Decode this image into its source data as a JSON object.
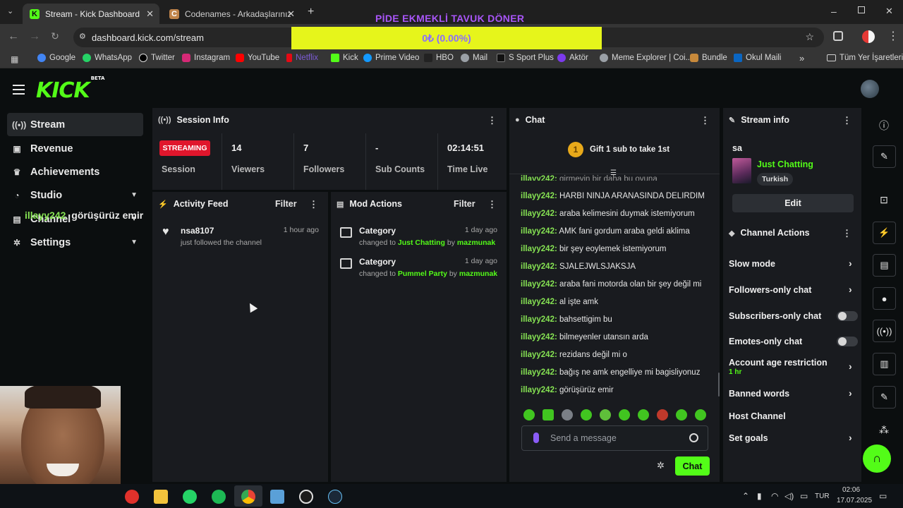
{
  "browser": {
    "tabs": [
      {
        "title": "Stream - Kick Dashboard",
        "active": true
      },
      {
        "title": "Codenames - Arkadaşlarınızla ç",
        "active": false
      }
    ],
    "url": "dashboard.kick.com/stream",
    "bookmarks": [
      "Google",
      "WhatsApp",
      "Twitter",
      "Instagram",
      "YouTube",
      "Netflix",
      "Kick",
      "Prime Video",
      "HBO",
      "Mail",
      "S Sport Plus",
      "Aktör",
      "Meme Explorer | Coi...",
      "Bundle",
      "Okul Maili"
    ],
    "bookmarks_more": "»",
    "all_bookmarks": "Tüm Yer İşaretleri"
  },
  "overlay": {
    "title": "PİDE EKMEKLİ TAVUK DÖNER",
    "progress_text": "0₺ (0.00%)",
    "progress": 0.0,
    "chat_user": "illayy242",
    "chat_text": "görüşürüz emir"
  },
  "kick": {
    "logo": "KICK",
    "logo_badge": "BETA"
  },
  "sidebar": {
    "items": [
      {
        "label": "Stream"
      },
      {
        "label": "Revenue"
      },
      {
        "label": "Achievements"
      },
      {
        "label": "Studio"
      },
      {
        "label": "Channel"
      },
      {
        "label": "Settings"
      }
    ]
  },
  "session": {
    "title": "Session Info",
    "badge": "STREAMING",
    "badge_label": "Session",
    "stats": [
      {
        "value": "14",
        "label": "Viewers"
      },
      {
        "value": "7",
        "label": "Followers"
      },
      {
        "value": "-",
        "label": "Sub Counts"
      },
      {
        "value": "02:14:51",
        "label": "Time Live"
      }
    ]
  },
  "activity": {
    "title": "Activity Feed",
    "filter": "Filter",
    "items": [
      {
        "user": "nsa8107",
        "text": "just followed the channel",
        "time": "1 hour ago"
      }
    ]
  },
  "mod": {
    "title": "Mod Actions",
    "filter": "Filter",
    "items": [
      {
        "title": "Category",
        "prefix": "changed to",
        "category": "Just Chatting",
        "by": "by",
        "mod": "mazmunak",
        "time": "1 day ago"
      },
      {
        "title": "Category",
        "prefix": "changed to",
        "category": "Pummel Party",
        "by": "by",
        "mod": "mazmunak",
        "time": "1 day ago"
      }
    ]
  },
  "chat": {
    "title": "Chat",
    "gift_number": "1",
    "gift_text": "Gift 1 sub to take 1st",
    "messages": [
      {
        "user": "illayy242:",
        "text": "HARBI NINJA ARANASINDA DELIRDIM"
      },
      {
        "user": "illayy242:",
        "text": "araba kelimesini duymak istemiyorum"
      },
      {
        "user": "illayy242:",
        "text": "AMK fani gordum araba geldi aklima"
      },
      {
        "user": "illayy242:",
        "text": "bir şey eoylemek istemiyorum"
      },
      {
        "user": "illayy242:",
        "text": "SJALEJWLSJAKSJA"
      },
      {
        "user": "illayy242:",
        "text": "araba fani motorda olan bir şey değil mi"
      },
      {
        "user": "illayy242:",
        "text": "al işte amk"
      },
      {
        "user": "illayy242:",
        "text": "bahsettigim bu"
      },
      {
        "user": "illayy242:",
        "text": "bilmeyenler utansın arda"
      },
      {
        "user": "illayy242:",
        "text": "rezidans değil mi o"
      },
      {
        "user": "illayy242:",
        "text": "bağış ne amk engelliye mi bagisliyonuz"
      },
      {
        "user": "illayy242:",
        "text": "görüşürüz emir"
      }
    ],
    "placeholder": "Send a message",
    "send": "Chat"
  },
  "stream_info": {
    "title": "Stream info",
    "stream_title": "sa",
    "category": "Just Chatting",
    "language": "Turkish",
    "edit": "Edit"
  },
  "channel_actions": {
    "title": "Channel Actions",
    "items": [
      {
        "label": "Slow mode",
        "kind": "chevron"
      },
      {
        "label": "Followers-only chat",
        "kind": "chevron"
      },
      {
        "label": "Subscribers-only chat",
        "kind": "toggle",
        "on": false
      },
      {
        "label": "Emotes-only chat",
        "kind": "toggle",
        "on": false
      },
      {
        "label": "Account age restriction",
        "sub": "1 hr",
        "kind": "chevron"
      },
      {
        "label": "Banned words",
        "kind": "chevron"
      },
      {
        "label": "Host Channel",
        "kind": "none"
      },
      {
        "label": "Set goals",
        "kind": "chevron"
      }
    ]
  },
  "taskbar": {
    "lang": "TUR",
    "time": "02:06",
    "date": "17.07.2025"
  },
  "colors": {
    "kick_green": "#53fc18",
    "streaming_red": "#e0162c",
    "panel": "#191b1f",
    "background": "#0b0e0f"
  }
}
